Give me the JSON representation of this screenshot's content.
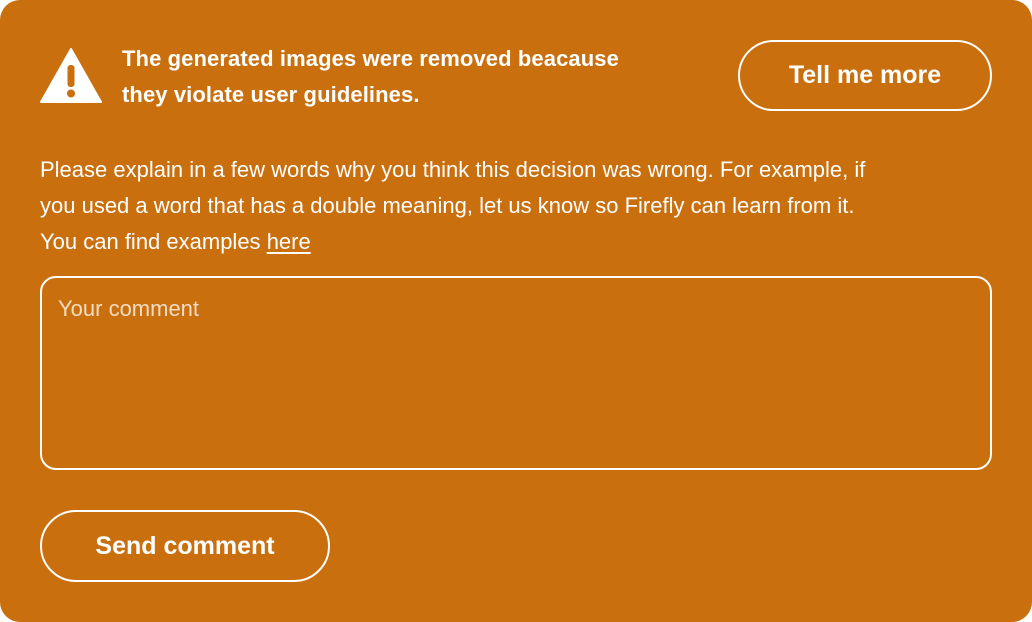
{
  "alert": {
    "icon": "warning-triangle-icon",
    "line1": "The generated images were removed beacause",
    "line2": "they violate user guidelines."
  },
  "buttons": {
    "tell_more_label": "Tell me more",
    "send_label": "Send comment"
  },
  "explanation": {
    "line1": "Please explain in a few words why you think this decision was wrong. For example, if",
    "line2": "you used a word that has a double meaning, let us know so Firefly can learn from it.",
    "line3_prefix": "You can find examples",
    "link_text": "here"
  },
  "comment": {
    "placeholder": "Your comment",
    "value": ""
  },
  "colors": {
    "background": "#c96f0e",
    "foreground": "#ffffff"
  }
}
